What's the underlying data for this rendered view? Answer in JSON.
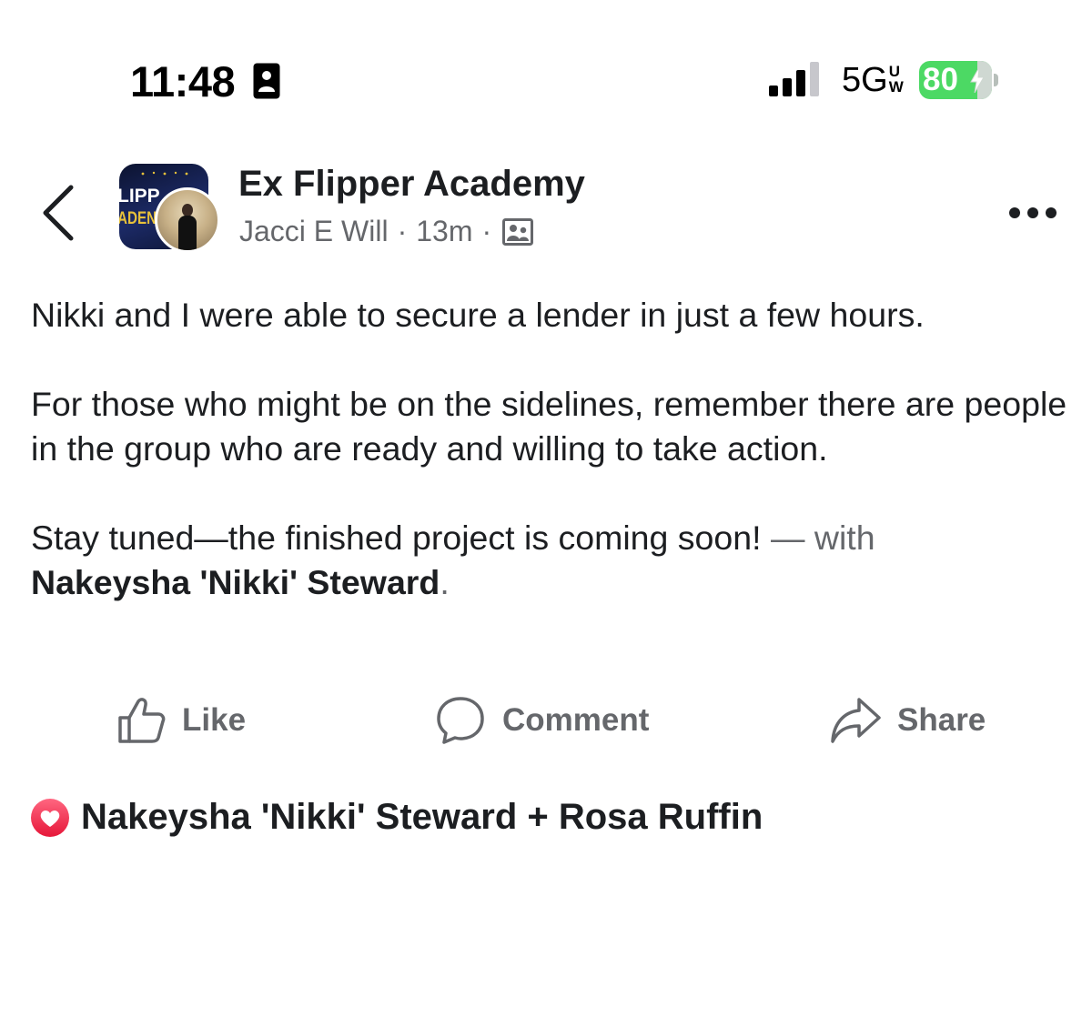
{
  "status_bar": {
    "time": "11:48",
    "network": "5G",
    "network_sup_top": "U",
    "network_sup_bottom": "W",
    "battery_level": "80",
    "battery_fraction": 0.8,
    "lockscreen_icon": "person-badge-icon",
    "signal_icon": "cellular-signal-icon",
    "charging_icon": "bolt-icon"
  },
  "post": {
    "group_name": "Ex Flipper Academy",
    "group_logo_line1": "LIPP",
    "group_logo_line2": "ADEN",
    "author": "Jacci E Will",
    "separator": "·",
    "time_ago": "13m",
    "audience_icon": "members-only-icon",
    "paragraphs": [
      "Nikki and I were able to secure a lender in just a few hours.",
      "For those who might be on the sidelines, remember there are people in the group who are ready and willing to take action.",
      "Stay tuned—the finished project is coming soon!"
    ],
    "with_text": " — with",
    "tagged_person": "Nakeysha 'Nikki' Steward",
    "tag_period": "."
  },
  "actions": {
    "like": "Like",
    "comment": "Comment",
    "share": "Share"
  },
  "reactions": {
    "names": "Nakeysha 'Nikki' Steward + Rosa Ruffin",
    "icon": "love-reaction-icon"
  },
  "colors": {
    "text": "#1c1e21",
    "secondary_text": "#65676b",
    "battery": "#4cd964",
    "love": "#f33e58"
  }
}
